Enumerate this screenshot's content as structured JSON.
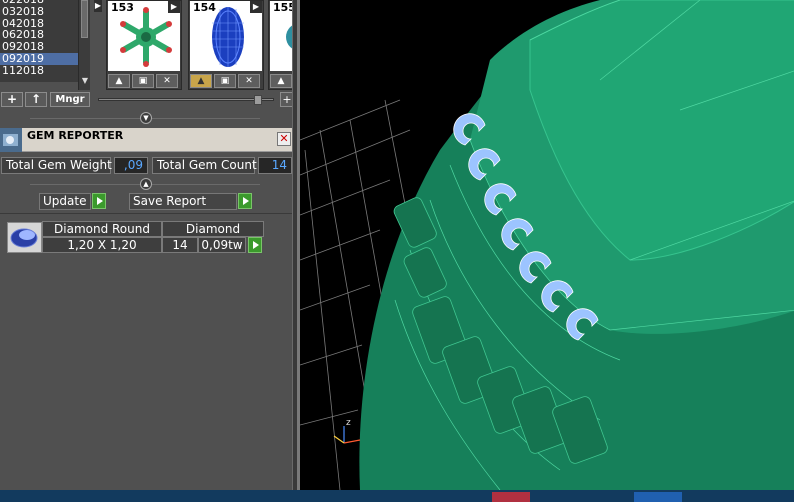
{
  "library": {
    "ids": [
      "022018",
      "032018",
      "042018",
      "062018",
      "092018",
      "092019",
      "112018"
    ],
    "selected_id": "092019",
    "thumbnails": [
      {
        "number": "153"
      },
      {
        "number": "154"
      },
      {
        "number": "155"
      }
    ],
    "buttons": {
      "manager": "Mngr"
    }
  },
  "gem_reporter": {
    "title": "GEM REPORTER",
    "total_weight_label": "Total Gem Weight",
    "total_weight_value": ",09",
    "total_count_label": "Total Gem Count",
    "total_count_value": "14",
    "update_label": "Update",
    "save_report_label": "Save Report",
    "rows": [
      {
        "shape": "Diamond Round",
        "material": "Diamond",
        "size": "1,20 X 1,20",
        "count": "14",
        "weight": "0,09tw"
      }
    ]
  },
  "viewport": {
    "axis_labels": {
      "z": "z"
    }
  },
  "colors": {
    "ring_green": "#1f9a6e",
    "gem_blue": "#9cc4ff",
    "selection_blue": "#4e6ea4",
    "go_green": "#3b9a2c",
    "value_blue": "#5aa8ff"
  }
}
